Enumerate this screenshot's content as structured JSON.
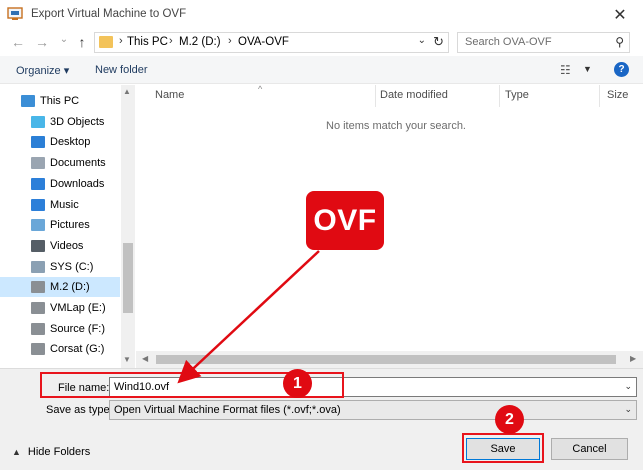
{
  "window": {
    "title": "Export Virtual Machine to OVF",
    "close_glyph": "✕"
  },
  "nav": {
    "back_glyph": "←",
    "forward_glyph": "→",
    "recent_glyph": "⌄",
    "up_glyph": "↑",
    "breadcrumbs": [
      "This PC",
      "M.2 (D:)",
      "OVA-OVF"
    ],
    "search_placeholder": "Search OVA-OVF"
  },
  "toolbar": {
    "organize_label": "Organize ▾",
    "new_folder_label": "New folder",
    "help_label": "?"
  },
  "sidebar": {
    "items": [
      {
        "label": "This PC",
        "icon": "computer-icon",
        "color": "#3b8ed6"
      },
      {
        "label": "3D Objects",
        "icon": "cube-icon",
        "color": "#49b6e8"
      },
      {
        "label": "Desktop",
        "icon": "desktop-icon",
        "color": "#2b7fd6"
      },
      {
        "label": "Documents",
        "icon": "document-icon",
        "color": "#9aa5b1"
      },
      {
        "label": "Downloads",
        "icon": "download-icon",
        "color": "#2c7fd9"
      },
      {
        "label": "Music",
        "icon": "music-icon",
        "color": "#2c7fd9"
      },
      {
        "label": "Pictures",
        "icon": "pictures-icon",
        "color": "#6aa7d8"
      },
      {
        "label": "Videos",
        "icon": "video-icon",
        "color": "#555e66"
      },
      {
        "label": "SYS (C:)",
        "icon": "drive-icon",
        "color": "#8ba0b3"
      },
      {
        "label": "M.2 (D:)",
        "icon": "drive-icon",
        "color": "#8a8f94"
      },
      {
        "label": "VMLap (E:)",
        "icon": "drive-icon",
        "color": "#8a8f94"
      },
      {
        "label": "Source (F:)",
        "icon": "drive-icon",
        "color": "#8a8f94"
      },
      {
        "label": "Corsat (G:)",
        "icon": "drive-icon",
        "color": "#8a8f94"
      }
    ]
  },
  "columns": {
    "name": "Name",
    "date": "Date modified",
    "type": "Type",
    "size": "Size"
  },
  "content": {
    "empty_message": "No items match your search."
  },
  "form": {
    "file_name_label": "File name:",
    "file_name_value": "Wind10.ovf",
    "save_type_label": "Save as type:",
    "save_type_value": "Open Virtual Machine Format files (*.ovf;*.ova)"
  },
  "footer": {
    "hide_folders_label": "Hide Folders",
    "save_label": "Save",
    "cancel_label": "Cancel"
  },
  "annotations": {
    "callout_text": "OVF",
    "badge1": "1",
    "badge2": "2",
    "accent_color": "#e00a12"
  }
}
